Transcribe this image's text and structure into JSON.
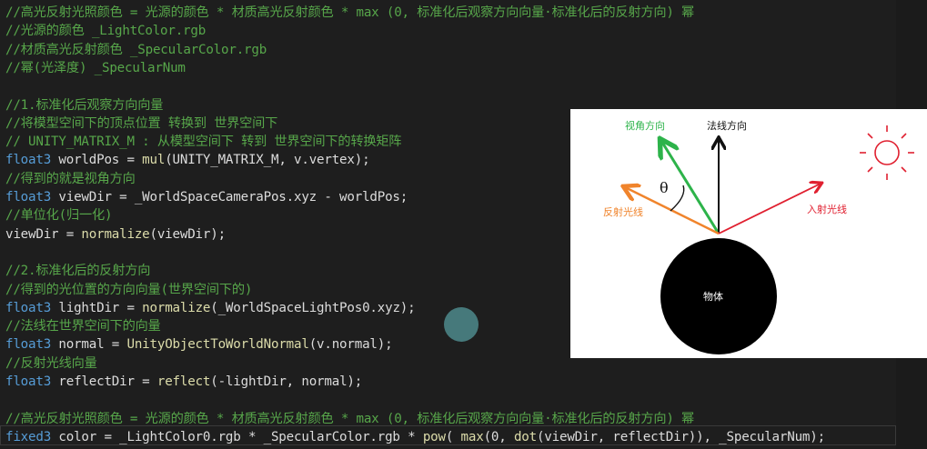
{
  "code_lines": [
    [
      {
        "t": "//高光反射光照颜色 = 光源的颜色 * 材质高光反射颜色 * max (0, 标准化后观察方向向量·标准化后的反射方向) 幂",
        "c": "comment"
      }
    ],
    [
      {
        "t": "//光源的颜色 _LightColor.rgb",
        "c": "comment"
      }
    ],
    [
      {
        "t": "//材质高光反射颜色 _SpecularColor.rgb",
        "c": "comment"
      }
    ],
    [
      {
        "t": "//幂(光泽度) _SpecularNum",
        "c": "comment"
      }
    ],
    [],
    [
      {
        "t": "//1.标准化后观察方向向量",
        "c": "comment"
      }
    ],
    [
      {
        "t": "//将模型空间下的顶点位置 转换到 世界空间下",
        "c": "comment"
      }
    ],
    [
      {
        "t": "// UNITY_MATRIX_M : 从模型空间下 转到 世界空间下的转换矩阵",
        "c": "comment"
      }
    ],
    [
      {
        "t": "float3",
        "c": "type"
      },
      {
        "t": " worldPos = ",
        "c": "plain"
      },
      {
        "t": "mul",
        "c": "func"
      },
      {
        "t": "(UNITY_MATRIX_M, v.vertex);",
        "c": "plain"
      }
    ],
    [
      {
        "t": "//得到的就是视角方向",
        "c": "comment"
      }
    ],
    [
      {
        "t": "float3",
        "c": "type"
      },
      {
        "t": " viewDir = _WorldSpaceCameraPos.xyz - worldPos;",
        "c": "plain"
      }
    ],
    [
      {
        "t": "//单位化(归一化)",
        "c": "comment"
      }
    ],
    [
      {
        "t": "viewDir = ",
        "c": "plain"
      },
      {
        "t": "normalize",
        "c": "func"
      },
      {
        "t": "(viewDir);",
        "c": "plain"
      }
    ],
    [],
    [
      {
        "t": "//2.标准化后的反射方向",
        "c": "comment"
      }
    ],
    [
      {
        "t": "//得到的光位置的方向向量(世界空间下的)",
        "c": "comment"
      }
    ],
    [
      {
        "t": "float3",
        "c": "type"
      },
      {
        "t": " lightDir = ",
        "c": "plain"
      },
      {
        "t": "normalize",
        "c": "func"
      },
      {
        "t": "(_WorldSpaceLightPos0.xyz);",
        "c": "plain"
      }
    ],
    [
      {
        "t": "//法线在世界空间下的向量",
        "c": "comment"
      }
    ],
    [
      {
        "t": "float3",
        "c": "type"
      },
      {
        "t": " normal = ",
        "c": "plain"
      },
      {
        "t": "UnityObjectToWorldNormal",
        "c": "func"
      },
      {
        "t": "(v.normal);",
        "c": "plain"
      }
    ],
    [
      {
        "t": "//反射光线向量",
        "c": "comment"
      }
    ],
    [
      {
        "t": "float3",
        "c": "type"
      },
      {
        "t": " reflectDir = ",
        "c": "plain"
      },
      {
        "t": "reflect",
        "c": "func"
      },
      {
        "t": "(-lightDir, normal);",
        "c": "plain"
      }
    ],
    [],
    [
      {
        "t": "//高光反射光照颜色 = 光源的颜色 * 材质高光反射颜色 * max (0, 标准化后观察方向向量·标准化后的反射方向) 幂",
        "c": "comment"
      }
    ],
    [
      {
        "t": "fixed3",
        "c": "type"
      },
      {
        "t": " color = _LightColor0.rgb * _SpecularColor.rgb * ",
        "c": "plain"
      },
      {
        "t": "pow",
        "c": "func"
      },
      {
        "t": "( ",
        "c": "plain"
      },
      {
        "t": "max",
        "c": "func"
      },
      {
        "t": "(0, ",
        "c": "plain"
      },
      {
        "t": "dot",
        "c": "func"
      },
      {
        "t": "(viewDir, reflectDir)), _SpecularNum);",
        "c": "plain"
      }
    ]
  ],
  "diagram": {
    "label_view": "视角方向",
    "label_normal": "法线方向",
    "label_reflect": "反射光线",
    "label_incident": "入射光线",
    "label_angle": "θ",
    "label_object": "物体",
    "colors": {
      "view": "#2db34a",
      "normal": "#111111",
      "reflect": "#f0842c",
      "incident": "#e02030",
      "sun": "#e02030"
    }
  }
}
